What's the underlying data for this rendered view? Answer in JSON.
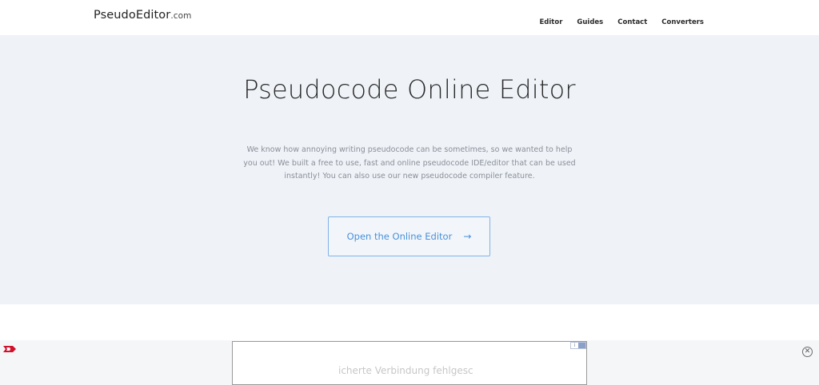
{
  "navbar": {
    "brand_name": "PseudoEditor",
    "brand_tld": ".com",
    "links": [
      {
        "label": "Editor"
      },
      {
        "label": "Guides"
      },
      {
        "label": "Contact"
      },
      {
        "label": "Converters"
      }
    ]
  },
  "hero": {
    "title": "Pseudocode Online Editor",
    "description": "We know how annoying writing pseudocode can be sometimes, so we wanted to help you out! We built a free to use, fast and online pseudocode IDE/editor that can be used instantly! You can also use our new pseudocode compiler feature.",
    "cta_label": "Open the Online Editor",
    "cta_arrow": "→"
  },
  "ad": {
    "frame_text": "icherte Verbindung fehlgesc",
    "choices_label": "i",
    "close_symbol": "✕",
    "logo_color": "#d0112b"
  },
  "colors": {
    "hero_bg": "#eff2f7",
    "accent": "#4a90d9"
  }
}
